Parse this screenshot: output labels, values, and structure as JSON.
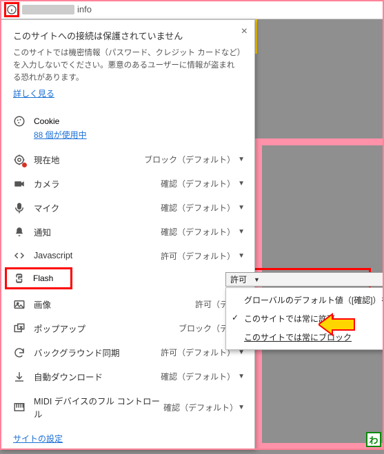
{
  "url_suffix": "info",
  "close_glyph": "×",
  "header": {
    "title": "このサイトへの接続は保護されていません",
    "desc": "このサイトでは機密情報（パスワード、クレジット カードなど）を入力しないでください。悪意のあるユーザーに情報が盗まれる恐れがあります。",
    "learn_more": "詳しく見る"
  },
  "cookie": {
    "label": "Cookie",
    "sub": "88 個が使用中"
  },
  "val_block_default": "ブロック（デフォルト）",
  "val_confirm_default": "確認（デフォルト）",
  "val_allow_default": "許可（デフォルト）",
  "val_allow_defa_trunc": "許可（デフォ",
  "val_block_defo_trunc": "ブロック（デフォ",
  "perm": {
    "location": "現在地",
    "camera": "カメラ",
    "mic": "マイク",
    "notif": "通知",
    "js": "Javascript",
    "flash": "Flash",
    "images": "画像",
    "popups": "ポップアップ",
    "bgsync": "バックグラウンド同期",
    "autodl": "自動ダウンロード",
    "midi": "MIDI デバイスのフル コントロール"
  },
  "footer_link": "サイトの設定",
  "dropdown": {
    "button": "許可",
    "opt_default": "グローバルのデフォルト値（[確認]）を使用",
    "opt_allow": "このサイトでは常に許可",
    "opt_block": "このサイトでは常にブロック"
  },
  "wa": "わ"
}
